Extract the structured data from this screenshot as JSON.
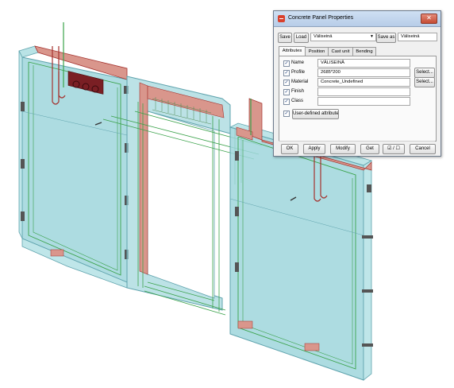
{
  "dialog": {
    "title": "Concrete Panel Properties",
    "close_glyph": "✕",
    "app_icon": "panel-properties-icon",
    "top_bar": {
      "save_label": "Save",
      "load_label": "Load",
      "load_value": "Väliseinä",
      "save_as_label": "Save as",
      "save_as_value": "Väliseinä"
    },
    "tabs": [
      {
        "label": "Attributes",
        "active": true
      },
      {
        "label": "Position",
        "active": false
      },
      {
        "label": "Cast unit",
        "active": false
      },
      {
        "label": "Bending",
        "active": false
      }
    ],
    "attributes": [
      {
        "checked": true,
        "label": "Name",
        "value": "VÄLISEINÄ",
        "button": ""
      },
      {
        "checked": true,
        "label": "Profile",
        "value": "2685*200",
        "button": "Select..."
      },
      {
        "checked": true,
        "label": "Material",
        "value": "Concrete_Undefined",
        "button": "Select..."
      },
      {
        "checked": true,
        "label": "Finish",
        "value": "",
        "button": ""
      },
      {
        "checked": true,
        "label": "Class",
        "value": "",
        "button": ""
      }
    ],
    "user_defined_label": "User-defined attributes...",
    "bottom_bar": {
      "ok_label": "OK",
      "apply_label": "Apply",
      "modify_label": "Modify",
      "get_label": "Get",
      "toggle_label": "☑ / ☐",
      "cancel_label": "Cancel"
    }
  },
  "colors": {
    "panel_fill": "#9fd6dc",
    "panel_edge": "#5fa3ad",
    "rebar_green": "#3aa24a",
    "rebar_red": "#a5322e",
    "insulation_pink": "#d9968c",
    "opening_white": "#ffffff"
  }
}
